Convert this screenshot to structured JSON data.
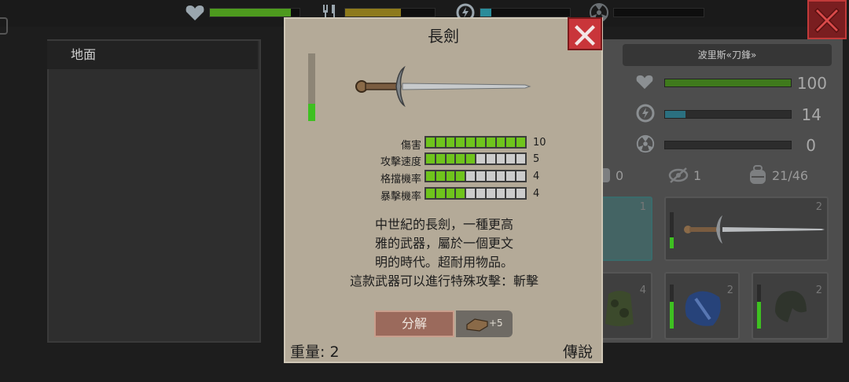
{
  "top_bar": {
    "health_fill": 0.9,
    "hunger_fill": 0.62,
    "energy_fill": 0.12,
    "radiation_fill": 0.0
  },
  "ground_panel": {
    "title": "地面"
  },
  "character": {
    "name": "波里斯«刀鋒»",
    "health": "100",
    "energy": "14",
    "radiation": "0",
    "stat_fill": {
      "health": 1.0,
      "energy": 0.16,
      "radiation": 0.0
    },
    "counts": {
      "defense": "0",
      "visibility": "1",
      "capacity": "21/46"
    }
  },
  "slots": [
    "1",
    "2",
    "4",
    "2",
    "2"
  ],
  "item_popup": {
    "name": "長劍",
    "durability_fill": 0.26,
    "stats": [
      {
        "label": "傷害",
        "value": "10",
        "segments_on": 10
      },
      {
        "label": "攻擊速度",
        "value": "5",
        "segments_on": 5
      },
      {
        "label": "格擋機率",
        "value": "4",
        "segments_on": 4
      },
      {
        "label": "暴擊機率",
        "value": "4",
        "segments_on": 4
      }
    ],
    "description": "中世紀的長劍，一種更高\n雅的武器，屬於一個更文\n明的時代。超耐用物品。\n這款武器可以進行特殊攻擊：斬擊",
    "disassemble_label": "分解",
    "disassemble_yield": "+5",
    "weight": "重量: 2",
    "rarity": "傳說"
  },
  "colors": {
    "popup_bg": "#b4aa98",
    "stat_green": "#6fc41c",
    "close_red": "#c9353a"
  }
}
